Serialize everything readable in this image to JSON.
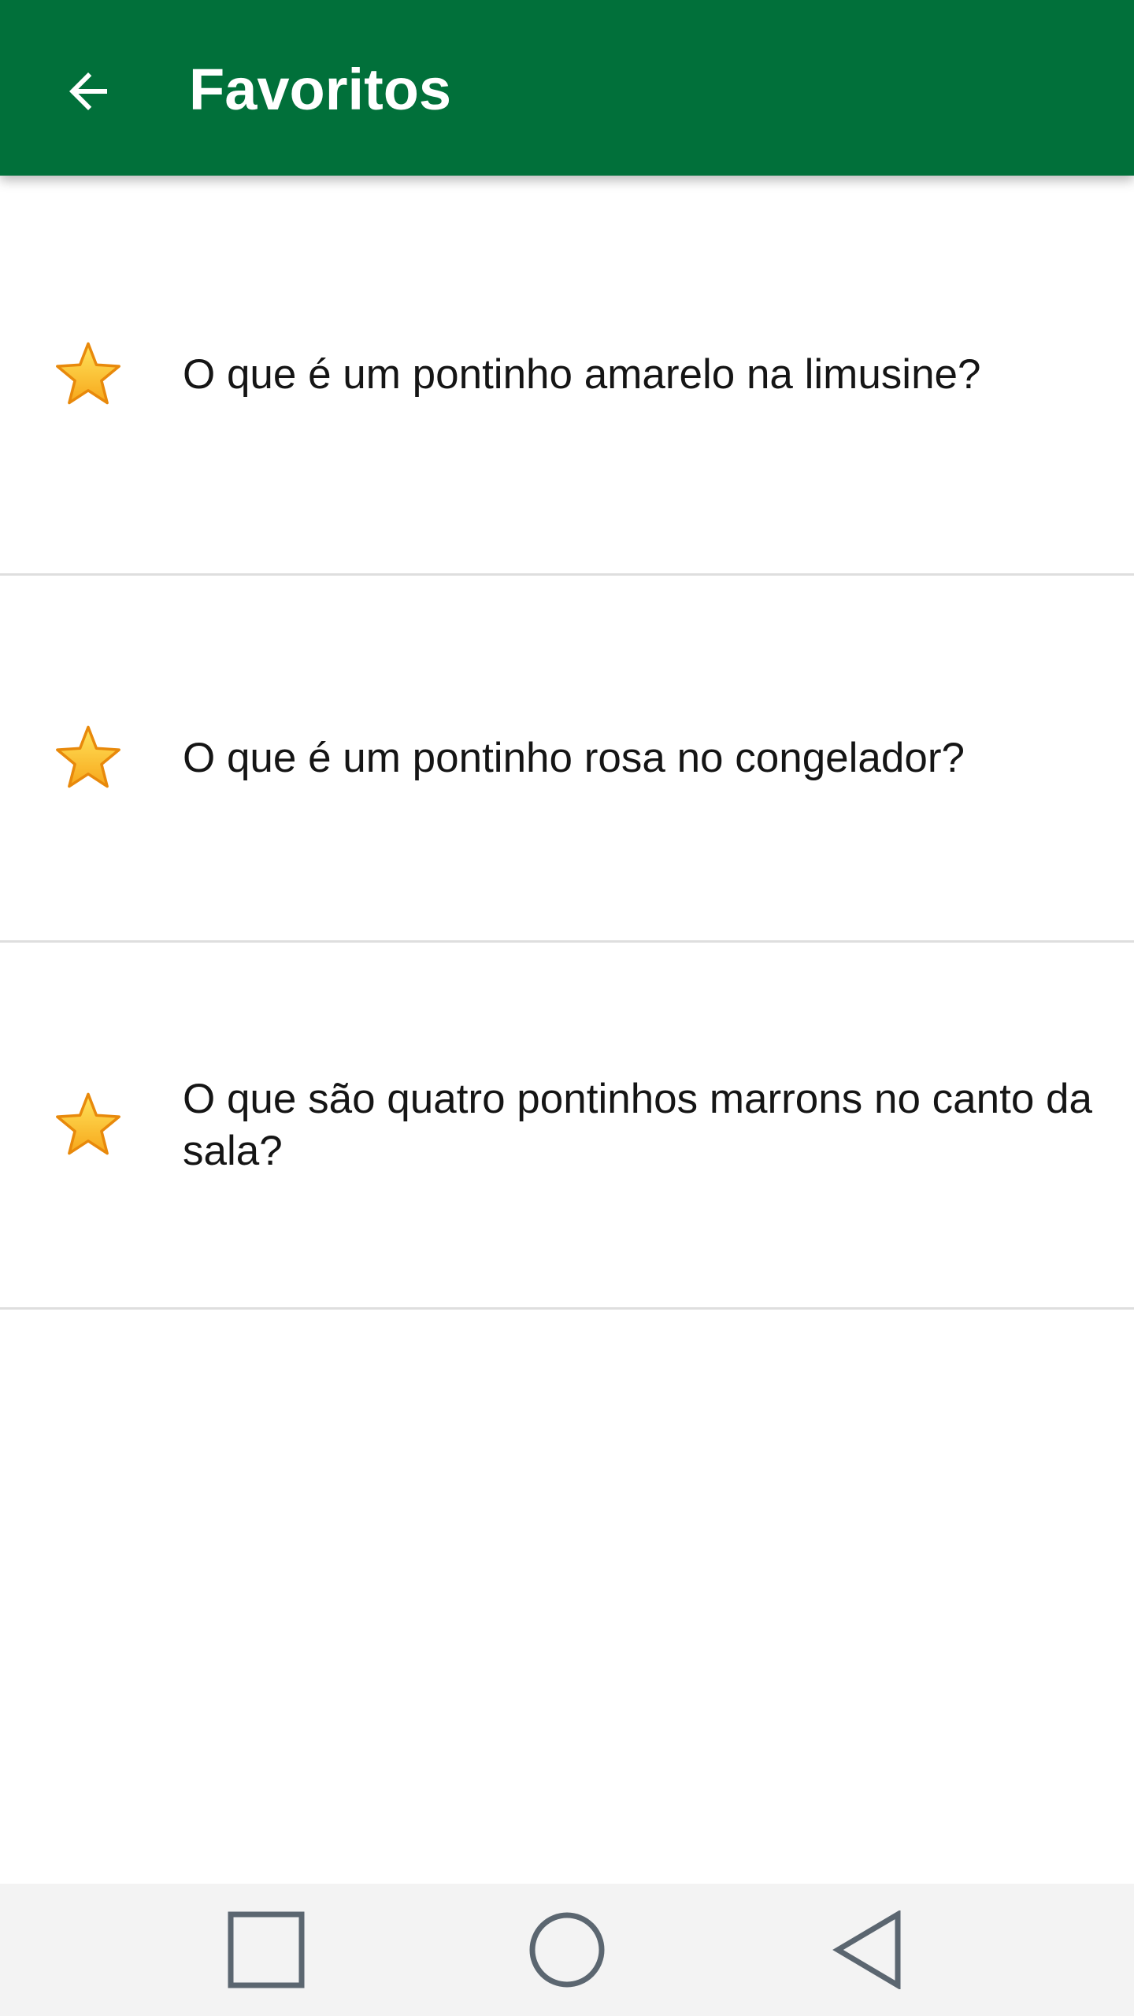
{
  "toolbar": {
    "title": "Favoritos",
    "background_color": "#01703a",
    "back_icon": "arrow-left-icon"
  },
  "favorites": {
    "star_icon": "star-icon",
    "star_color": "#fbbf24",
    "items": [
      {
        "text": "O que é um pontinho amarelo na limusine?"
      },
      {
        "text": "O que é um pontinho rosa no congelador?"
      },
      {
        "text": "O que são quatro pontinhos marrons no canto da sala?"
      }
    ]
  },
  "navbar": {
    "background_color": "#f3f3f3",
    "icon_color": "#5b6670",
    "buttons": [
      "recents-square-icon",
      "home-circle-icon",
      "back-triangle-icon"
    ]
  }
}
